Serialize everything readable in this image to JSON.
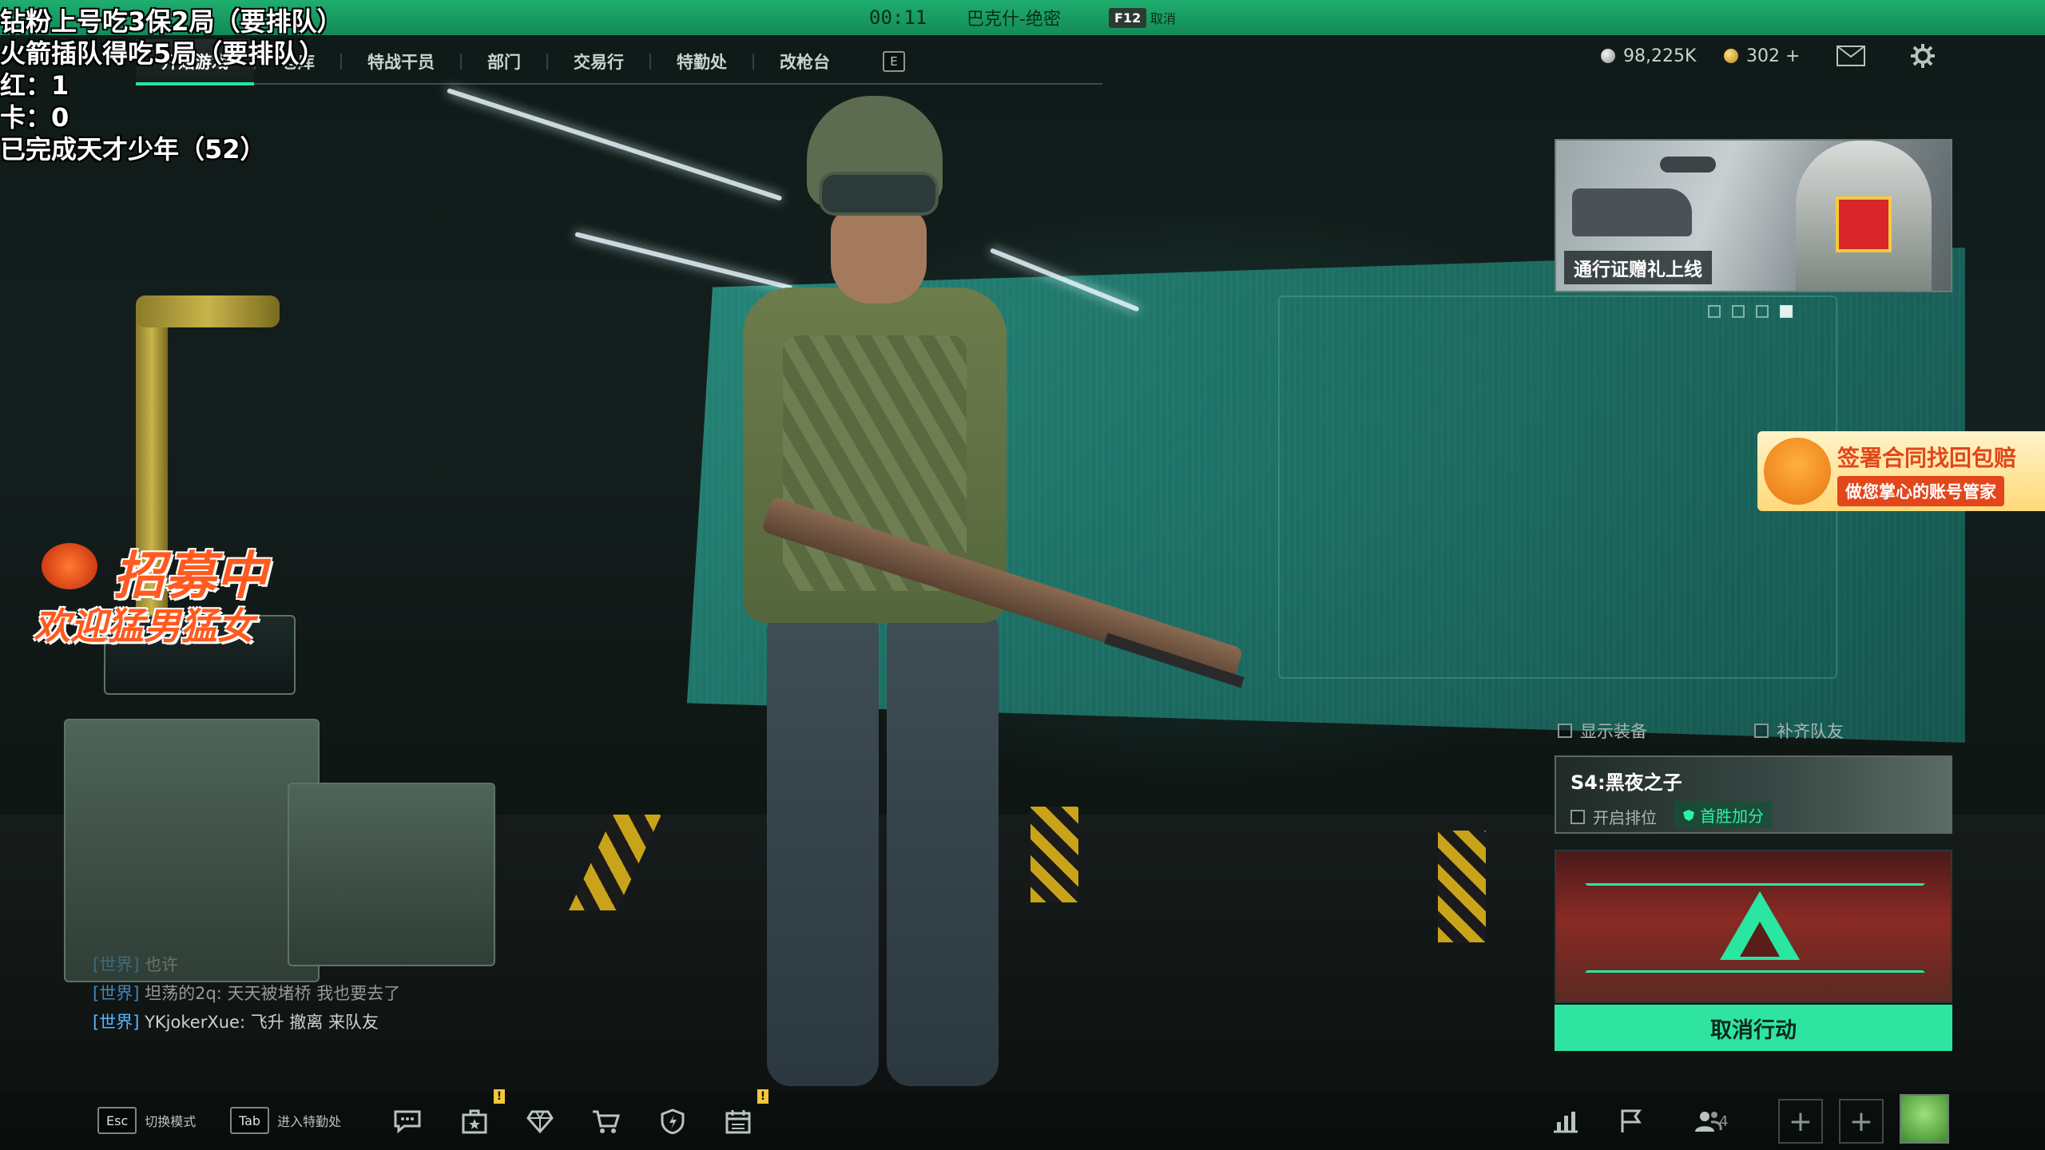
{
  "status_bar": {
    "time": "00:11",
    "map_name": "巴克什-绝密",
    "key_hint": "F12",
    "key_action": "取消"
  },
  "overlay": {
    "line1": "钻粉上号吃3保2局（要排队）",
    "line2": "火箭插队得吃5局（要排队）",
    "line3": "红：1",
    "line4": "卡：0",
    "line5": "已完成天才少年（52）"
  },
  "nav": {
    "tabs": [
      {
        "label": "开始游戏",
        "active": true
      },
      {
        "label": "仓库"
      },
      {
        "label": "特战干员"
      },
      {
        "label": "部门"
      },
      {
        "label": "交易行"
      },
      {
        "label": "特勤处"
      },
      {
        "label": "改枪台"
      }
    ],
    "key_hint": "E"
  },
  "currency": {
    "silver": "98,225K",
    "gold": "302 +"
  },
  "promo": {
    "label": "通行证赠礼上线"
  },
  "ad": {
    "line1": "签署合同找回包赔",
    "line2": "做您掌心的账号管家"
  },
  "options": {
    "show_gear": "显示装备",
    "fill_squad": "补齐队友"
  },
  "season": {
    "title": "S4:黑夜之子",
    "ranked_label": "开启排位",
    "first_win_label": "首胜加分"
  },
  "action": {
    "button_label": "取消行动"
  },
  "recruit": {
    "line1": "招募中",
    "line2": "欢迎猛男猛女"
  },
  "chat": [
    {
      "channel": "[世界]",
      "text": "也许",
      "faded": true
    },
    {
      "channel": "[世界]",
      "text": "坦荡的2q: 天天被堵桥  我也要去了",
      "dim": true
    },
    {
      "channel": "[世界]",
      "text": "YKjokerXue: 飞升 撤离 来队友"
    }
  ],
  "bottom": {
    "esc_key": "Esc",
    "esc_label": "切换模式",
    "tab_key": "Tab",
    "tab_label": "进入特勤处",
    "alert_mark": "!",
    "squad_count": "4"
  },
  "colors": {
    "accent": "#2fe4a0",
    "topbar": "#1fae6f",
    "chat_channel": "#56b5ff"
  }
}
